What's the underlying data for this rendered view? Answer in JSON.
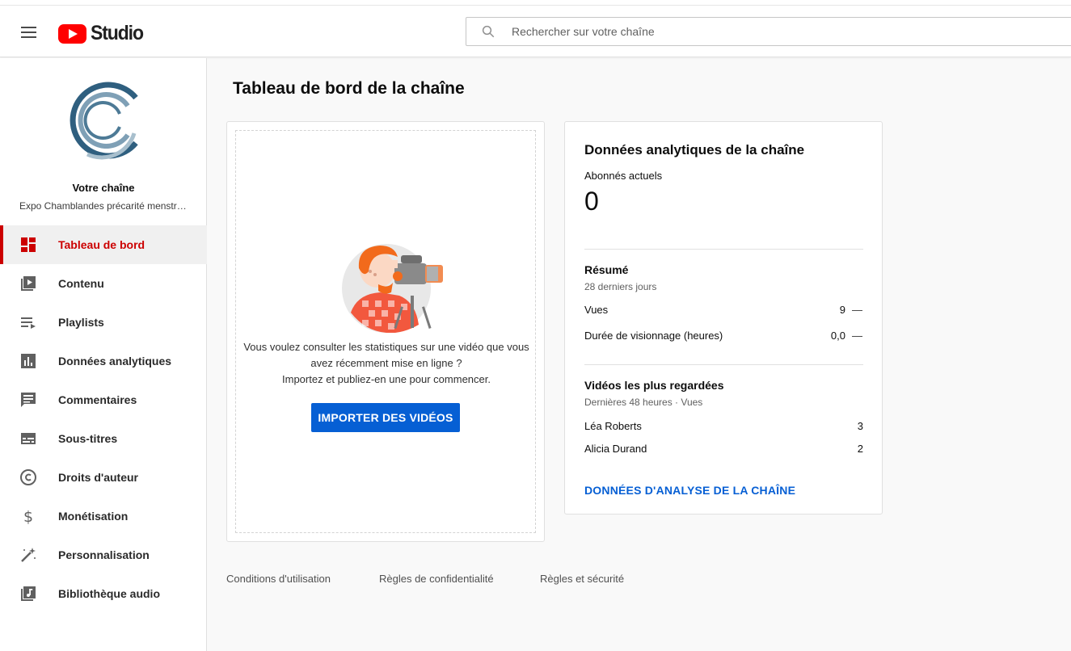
{
  "header": {
    "logo_text": "Studio",
    "search_placeholder": "Rechercher sur votre chaîne"
  },
  "sidebar": {
    "channel_title": "Votre chaîne",
    "channel_name": "Expo Chamblandes précarité menstr…",
    "items": [
      {
        "label": "Tableau de bord",
        "icon": "dashboard-icon",
        "active": true
      },
      {
        "label": "Contenu",
        "icon": "video-library-icon"
      },
      {
        "label": "Playlists",
        "icon": "playlist-icon"
      },
      {
        "label": "Données analytiques",
        "icon": "analytics-icon"
      },
      {
        "label": "Commentaires",
        "icon": "comment-icon"
      },
      {
        "label": "Sous-titres",
        "icon": "subtitles-icon"
      },
      {
        "label": "Droits d'auteur",
        "icon": "copyright-icon"
      },
      {
        "label": "Monétisation",
        "icon": "dollar-icon"
      },
      {
        "label": "Personnalisation",
        "icon": "magic-wand-icon"
      },
      {
        "label": "Bibliothèque audio",
        "icon": "audio-library-icon"
      }
    ]
  },
  "main": {
    "title": "Tableau de bord de la chaîne",
    "upload": {
      "line1": "Vous voulez consulter les statistiques sur une vidéo que vous",
      "line2": "avez récemment mise en ligne ?",
      "line3": "Importez et publiez-en une pour commencer.",
      "button": "IMPORTER DES VIDÉOS"
    },
    "analytics": {
      "title": "Données analytiques de la chaîne",
      "subscribers_label": "Abonnés actuels",
      "subscribers_count": "0",
      "summary_title": "Résumé",
      "summary_period": "28 derniers jours",
      "views_label": "Vues",
      "views_value": "9",
      "views_change": "—",
      "watch_label": "Durée de visionnage (heures)",
      "watch_value": "0,0",
      "watch_change": "—",
      "top_title": "Vidéos les plus regardées",
      "top_period": "Dernières 48 heures · Vues",
      "top_videos": [
        {
          "name": "Léa Roberts",
          "views": "3"
        },
        {
          "name": "Alicia Durand",
          "views": "2"
        }
      ],
      "link": "DONNÉES D'ANALYSE DE LA CHAÎNE"
    }
  },
  "footer": {
    "terms": "Conditions d'utilisation",
    "privacy": "Règles de confidentialité",
    "safety": "Règles et sécurité"
  },
  "colors": {
    "brand_red": "#ff0000",
    "active_red": "#cc0000",
    "accent_blue": "#065fd4"
  }
}
